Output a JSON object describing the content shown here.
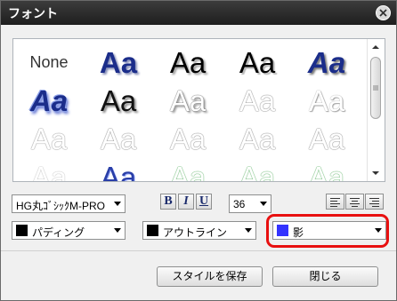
{
  "window": {
    "title": "フォント"
  },
  "gallery": {
    "none_label": "None",
    "sample_text": "Aa"
  },
  "toolbar": {
    "font_name": "HG丸ｺﾞｼｯｸM-PRO",
    "bold": "B",
    "italic": "I",
    "underline": "U",
    "font_size": "36"
  },
  "effects": {
    "padding": {
      "label": "パディング",
      "color": "#000000"
    },
    "outline": {
      "label": "アウトライン",
      "color": "#000000"
    },
    "shadow": {
      "label": "影",
      "color": "#3333ff"
    }
  },
  "buttons": {
    "save_style": "スタイルを保存",
    "close": "閉じる"
  }
}
